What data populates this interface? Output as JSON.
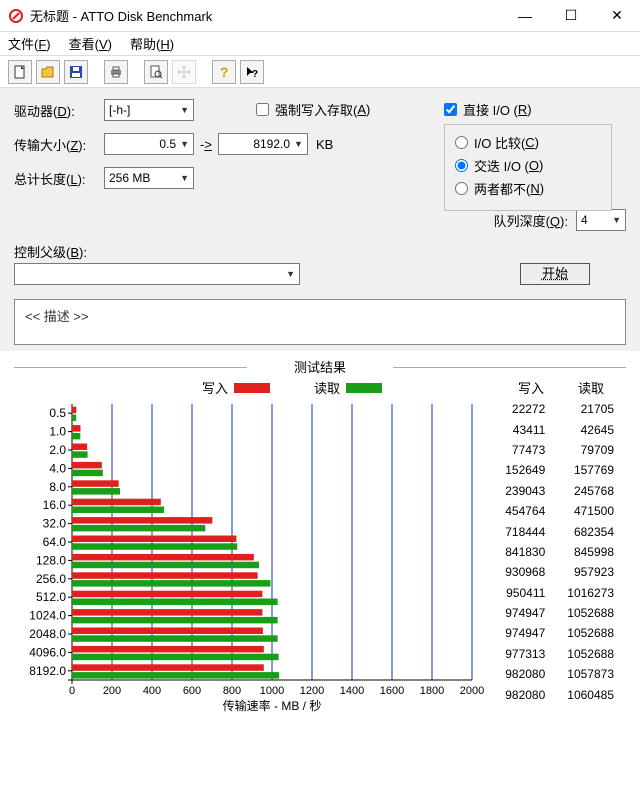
{
  "window": {
    "title": "无标题 - ATTO Disk Benchmark"
  },
  "menu": {
    "file": "文件(F)",
    "view": "查看(V)",
    "help": "帮助(H)"
  },
  "form": {
    "drive_label": "驱动器(D):",
    "drive_value": "[-h-]",
    "transfer_label": "传输大小(Z):",
    "transfer_from": "0.5",
    "transfer_op": "->",
    "transfer_to": "8192.0",
    "transfer_unit": "KB",
    "total_label": "总计长度(L):",
    "total_value": "256 MB",
    "force_write": "强制写入存取(A)",
    "direct_io": "直接 I/O (R)",
    "io_compare": "I/O 比较(C)",
    "overlapped_io": "交迭 I/O (O)",
    "neither": "两者都不(N)",
    "queue_label": "队列深度(Q):",
    "queue_value": "4",
    "parent_label": "控制父级(B):",
    "start": "开始",
    "description": "<< 描述 >>"
  },
  "chart_data": {
    "type": "bar",
    "title": "测试结果",
    "legend_write": "写入",
    "legend_read": "读取",
    "xlabel": "传输速率 - MB / 秒",
    "x_ticks": [
      0,
      200,
      400,
      600,
      800,
      1000,
      1200,
      1400,
      1600,
      1800,
      2000
    ],
    "xlim": [
      0,
      2000
    ],
    "table_headers": {
      "write": "写入",
      "read": "读取"
    },
    "categories": [
      "0.5",
      "1.0",
      "2.0",
      "4.0",
      "8.0",
      "16.0",
      "32.0",
      "64.0",
      "128.0",
      "256.0",
      "512.0",
      "1024.0",
      "2048.0",
      "4096.0",
      "8192.0"
    ],
    "series": [
      {
        "name": "写入",
        "color": "#e01f1f",
        "values_kb": [
          22272,
          43411,
          77473,
          152649,
          239043,
          454764,
          718444,
          841830,
          930968,
          950411,
          974947,
          974947,
          977313,
          982080,
          982080
        ]
      },
      {
        "name": "读取",
        "color": "#1a9e1a",
        "values_kb": [
          21705,
          42645,
          79709,
          157769,
          245768,
          471500,
          682354,
          845998,
          957923,
          1016273,
          1052688,
          1052688,
          1052688,
          1057873,
          1060485
        ]
      }
    ]
  }
}
